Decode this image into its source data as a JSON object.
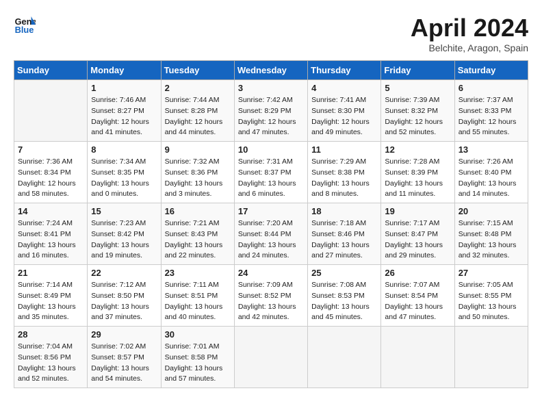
{
  "header": {
    "logo_line1": "General",
    "logo_line2": "Blue",
    "month": "April 2024",
    "location": "Belchite, Aragon, Spain"
  },
  "days_of_week": [
    "Sunday",
    "Monday",
    "Tuesday",
    "Wednesday",
    "Thursday",
    "Friday",
    "Saturday"
  ],
  "weeks": [
    [
      {
        "day": "",
        "info": ""
      },
      {
        "day": "1",
        "info": "Sunrise: 7:46 AM\nSunset: 8:27 PM\nDaylight: 12 hours\nand 41 minutes."
      },
      {
        "day": "2",
        "info": "Sunrise: 7:44 AM\nSunset: 8:28 PM\nDaylight: 12 hours\nand 44 minutes."
      },
      {
        "day": "3",
        "info": "Sunrise: 7:42 AM\nSunset: 8:29 PM\nDaylight: 12 hours\nand 47 minutes."
      },
      {
        "day": "4",
        "info": "Sunrise: 7:41 AM\nSunset: 8:30 PM\nDaylight: 12 hours\nand 49 minutes."
      },
      {
        "day": "5",
        "info": "Sunrise: 7:39 AM\nSunset: 8:32 PM\nDaylight: 12 hours\nand 52 minutes."
      },
      {
        "day": "6",
        "info": "Sunrise: 7:37 AM\nSunset: 8:33 PM\nDaylight: 12 hours\nand 55 minutes."
      }
    ],
    [
      {
        "day": "7",
        "info": "Sunrise: 7:36 AM\nSunset: 8:34 PM\nDaylight: 12 hours\nand 58 minutes."
      },
      {
        "day": "8",
        "info": "Sunrise: 7:34 AM\nSunset: 8:35 PM\nDaylight: 13 hours\nand 0 minutes."
      },
      {
        "day": "9",
        "info": "Sunrise: 7:32 AM\nSunset: 8:36 PM\nDaylight: 13 hours\nand 3 minutes."
      },
      {
        "day": "10",
        "info": "Sunrise: 7:31 AM\nSunset: 8:37 PM\nDaylight: 13 hours\nand 6 minutes."
      },
      {
        "day": "11",
        "info": "Sunrise: 7:29 AM\nSunset: 8:38 PM\nDaylight: 13 hours\nand 8 minutes."
      },
      {
        "day": "12",
        "info": "Sunrise: 7:28 AM\nSunset: 8:39 PM\nDaylight: 13 hours\nand 11 minutes."
      },
      {
        "day": "13",
        "info": "Sunrise: 7:26 AM\nSunset: 8:40 PM\nDaylight: 13 hours\nand 14 minutes."
      }
    ],
    [
      {
        "day": "14",
        "info": "Sunrise: 7:24 AM\nSunset: 8:41 PM\nDaylight: 13 hours\nand 16 minutes."
      },
      {
        "day": "15",
        "info": "Sunrise: 7:23 AM\nSunset: 8:42 PM\nDaylight: 13 hours\nand 19 minutes."
      },
      {
        "day": "16",
        "info": "Sunrise: 7:21 AM\nSunset: 8:43 PM\nDaylight: 13 hours\nand 22 minutes."
      },
      {
        "day": "17",
        "info": "Sunrise: 7:20 AM\nSunset: 8:44 PM\nDaylight: 13 hours\nand 24 minutes."
      },
      {
        "day": "18",
        "info": "Sunrise: 7:18 AM\nSunset: 8:46 PM\nDaylight: 13 hours\nand 27 minutes."
      },
      {
        "day": "19",
        "info": "Sunrise: 7:17 AM\nSunset: 8:47 PM\nDaylight: 13 hours\nand 29 minutes."
      },
      {
        "day": "20",
        "info": "Sunrise: 7:15 AM\nSunset: 8:48 PM\nDaylight: 13 hours\nand 32 minutes."
      }
    ],
    [
      {
        "day": "21",
        "info": "Sunrise: 7:14 AM\nSunset: 8:49 PM\nDaylight: 13 hours\nand 35 minutes."
      },
      {
        "day": "22",
        "info": "Sunrise: 7:12 AM\nSunset: 8:50 PM\nDaylight: 13 hours\nand 37 minutes."
      },
      {
        "day": "23",
        "info": "Sunrise: 7:11 AM\nSunset: 8:51 PM\nDaylight: 13 hours\nand 40 minutes."
      },
      {
        "day": "24",
        "info": "Sunrise: 7:09 AM\nSunset: 8:52 PM\nDaylight: 13 hours\nand 42 minutes."
      },
      {
        "day": "25",
        "info": "Sunrise: 7:08 AM\nSunset: 8:53 PM\nDaylight: 13 hours\nand 45 minutes."
      },
      {
        "day": "26",
        "info": "Sunrise: 7:07 AM\nSunset: 8:54 PM\nDaylight: 13 hours\nand 47 minutes."
      },
      {
        "day": "27",
        "info": "Sunrise: 7:05 AM\nSunset: 8:55 PM\nDaylight: 13 hours\nand 50 minutes."
      }
    ],
    [
      {
        "day": "28",
        "info": "Sunrise: 7:04 AM\nSunset: 8:56 PM\nDaylight: 13 hours\nand 52 minutes."
      },
      {
        "day": "29",
        "info": "Sunrise: 7:02 AM\nSunset: 8:57 PM\nDaylight: 13 hours\nand 54 minutes."
      },
      {
        "day": "30",
        "info": "Sunrise: 7:01 AM\nSunset: 8:58 PM\nDaylight: 13 hours\nand 57 minutes."
      },
      {
        "day": "",
        "info": ""
      },
      {
        "day": "",
        "info": ""
      },
      {
        "day": "",
        "info": ""
      },
      {
        "day": "",
        "info": ""
      }
    ]
  ]
}
